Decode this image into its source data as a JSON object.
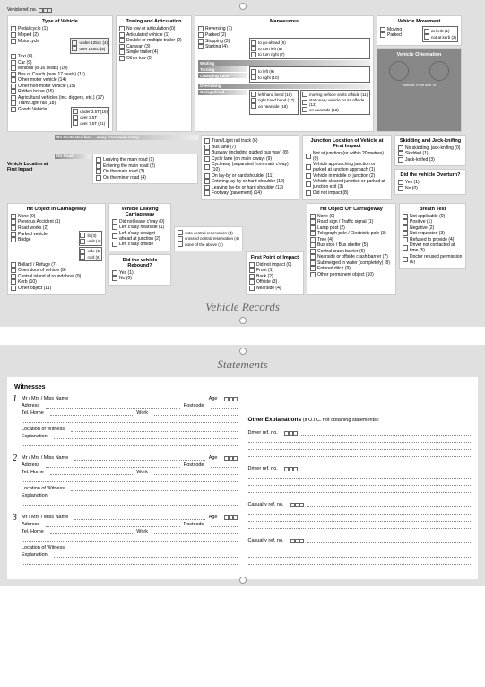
{
  "page1": {
    "vref_label": "Vehicle ref. no.",
    "type_of_vehicle": {
      "title": "Type of Vehicle",
      "items": [
        "Pedal cycle (1)",
        "Moped (2)",
        "Motorcycle",
        "Taxi (8)",
        "Car (9)",
        "Minibus (8-16 seats) (10)",
        "Bus or Coach (over 17 seats) (11)",
        "Other motor vehicle (14)",
        "Other non-motor vehicle (15)",
        "Ridden horse (16)",
        "Agricultural vehicles (inc. diggers, etc.) (17)",
        "Tram/Light rail (18)",
        "Goods Vehicle"
      ],
      "sub1": [
        "under 125cc (4)",
        "over 125cc (5)"
      ],
      "sub2": [
        "under 3.5T (19)",
        "over 3.5T",
        "over 7.5T (21)"
      ]
    },
    "towing": {
      "title": "Towing and Articulation",
      "items": [
        "No tow or articulation (0)",
        "Articulated vehicle (1)",
        "Double or multiple trailer (2)",
        "Caravan (3)",
        "Single trailer (4)",
        "Other tow (5)"
      ]
    },
    "manoeuvres": {
      "title": "Manoeuvres",
      "items": [
        "Reversing (1)",
        "Parked (2)",
        "Stopping (3)",
        "Starting (4)",
        "Waiting",
        "Turning",
        "Changing Lane",
        "Overtaking",
        "Going ahead"
      ],
      "sub1": [
        "to go-ahead (5)",
        "to turn left (6)",
        "to turn right (7)"
      ],
      "sub2": [
        "to left (9)",
        "to right (10)"
      ],
      "sub3": [
        "left hand bend (16)",
        "right hand bend (17)",
        "on nearside (18)"
      ],
      "sub4": [
        "moving vehicle on its offside (11)",
        "stationary vehicle on its offside (12)",
        "on nearside (13)"
      ]
    },
    "movement": {
      "title": "Vehicle Movement",
      "items": [
        "Moving",
        "Parked"
      ],
      "sub": [
        "at kerb (1)",
        "not at kerb (2)"
      ]
    },
    "orientation": {
      "title": "Vehicle Orientation",
      "note": "Indicate From and To"
    },
    "location": {
      "label": "Vehicle Location at First Impact",
      "restricted": "On Restricted lane – away from main c'way",
      "onroad": "On Road",
      "items1": [
        "Leaving the main road (1)",
        "Entering the main road (2)",
        "On the main road (3)",
        "On the minor road (4)"
      ],
      "items2": [
        "Tram/Light rail track (6)",
        "Bus lane (7)",
        "Busway (including guided bus way) (8)",
        "Cycle lane (on main c'way) (9)",
        "Cycleway (separated from main c'way) (10)",
        "On lay-by or hard shoulder (11)",
        "Entering lay-by or hard shoulder (12)",
        "Leaving lay-by or hard shoulder (13)",
        "Footway (pavement) (14)"
      ]
    },
    "junction": {
      "title": "Junction Location of Vehicle at First Impact",
      "items": [
        "Not at junction (or within 20 metres) (0)",
        "Vehicle approaching junction or parked at junction approach (1)",
        "Vehicle in middle of junction (2)",
        "Vehicle cleared junction or parked at junction exit (3)",
        "Did not impact (8)"
      ]
    },
    "skidding": {
      "title": "Skidding and Jack-knifing",
      "items": [
        "No skidding, jack-knifing (0)",
        "Skidded (1)",
        "Jack-knifed (3)"
      ]
    },
    "overturn": {
      "title": "Did the vehicle Overturn?",
      "items": [
        "Yes (1)",
        "No (0)"
      ]
    },
    "hit_on": {
      "title": "Hit Object In Carriageway",
      "items": [
        "None (0)",
        "Previous Accident (1)",
        "Road works (2)",
        "Parked vehicle",
        "Bridge",
        "Bollard / Refuge (7)",
        "Open door of vehicle (8)",
        "Central island of roundabout (9)",
        "Kerb (10)",
        "Other object (11)"
      ],
      "sub1": [
        "lit (3)",
        "unlit (4)"
      ],
      "sub2": [
        "side (5)",
        "roof (6)"
      ]
    },
    "leaving": {
      "title": "Vehicle Leaving Carriageway",
      "items": [
        "Did not leave c'way (0)",
        "Left c'way nearside (1)",
        "Left c'way straight ahead at junction (2)",
        "Left c'way offside"
      ],
      "sub": [
        "onto central reservation (3)",
        "crossed central reservation (4)",
        "none of the above (7)"
      ],
      "rebound": "Did the vehicle Rebound?",
      "rebound_items": [
        "Yes (1)",
        "No (0)"
      ]
    },
    "first_point": {
      "title": "First Point of Impact",
      "items": [
        "Did not impact (0)",
        "Front (1)",
        "Back (2)",
        "Offside (3)",
        "Nearside (4)"
      ]
    },
    "hit_off": {
      "title": "Hit Object Off Carriageway",
      "items": [
        "None (0)",
        "Road sign / Traffic signal (1)",
        "Lamp post (2)",
        "Telegraph pole / Electricity pole (3)",
        "Tree (4)",
        "Bus stop / Bus shelter (5)",
        "Central crash barrier (6)",
        "Nearside or offside crash barrier (7)",
        "Submerged in water (completely) (8)",
        "Entered ditch (9)",
        "Other permanent object (10)"
      ]
    },
    "breath": {
      "title": "Breath Test",
      "items": [
        "Not applicable (0)",
        "Positive (1)",
        "Negative (2)",
        "Not requested (3)",
        "Refused to provide (4)",
        "Driver not contacted at time (5)",
        "Doctor refused permission (6)"
      ]
    },
    "footer": "Vehicle Records"
  },
  "page2": {
    "title": "Statements",
    "witnesses_title": "Witnesses",
    "labels": {
      "name": "Mr / Mrs / Miss  Name",
      "age": "Age",
      "address": "Address",
      "postcode": "Postcode",
      "tel_home": "Tel.  Home",
      "work": "Work",
      "loc": "Location of Witness",
      "expl": "Explanation"
    },
    "other_title": "Other Explanations",
    "other_sub": "(if O.I.C. not obtaining statements):",
    "driver_ref": "Driver  ref. no.",
    "casualty_ref": "Casualty ref. no."
  }
}
